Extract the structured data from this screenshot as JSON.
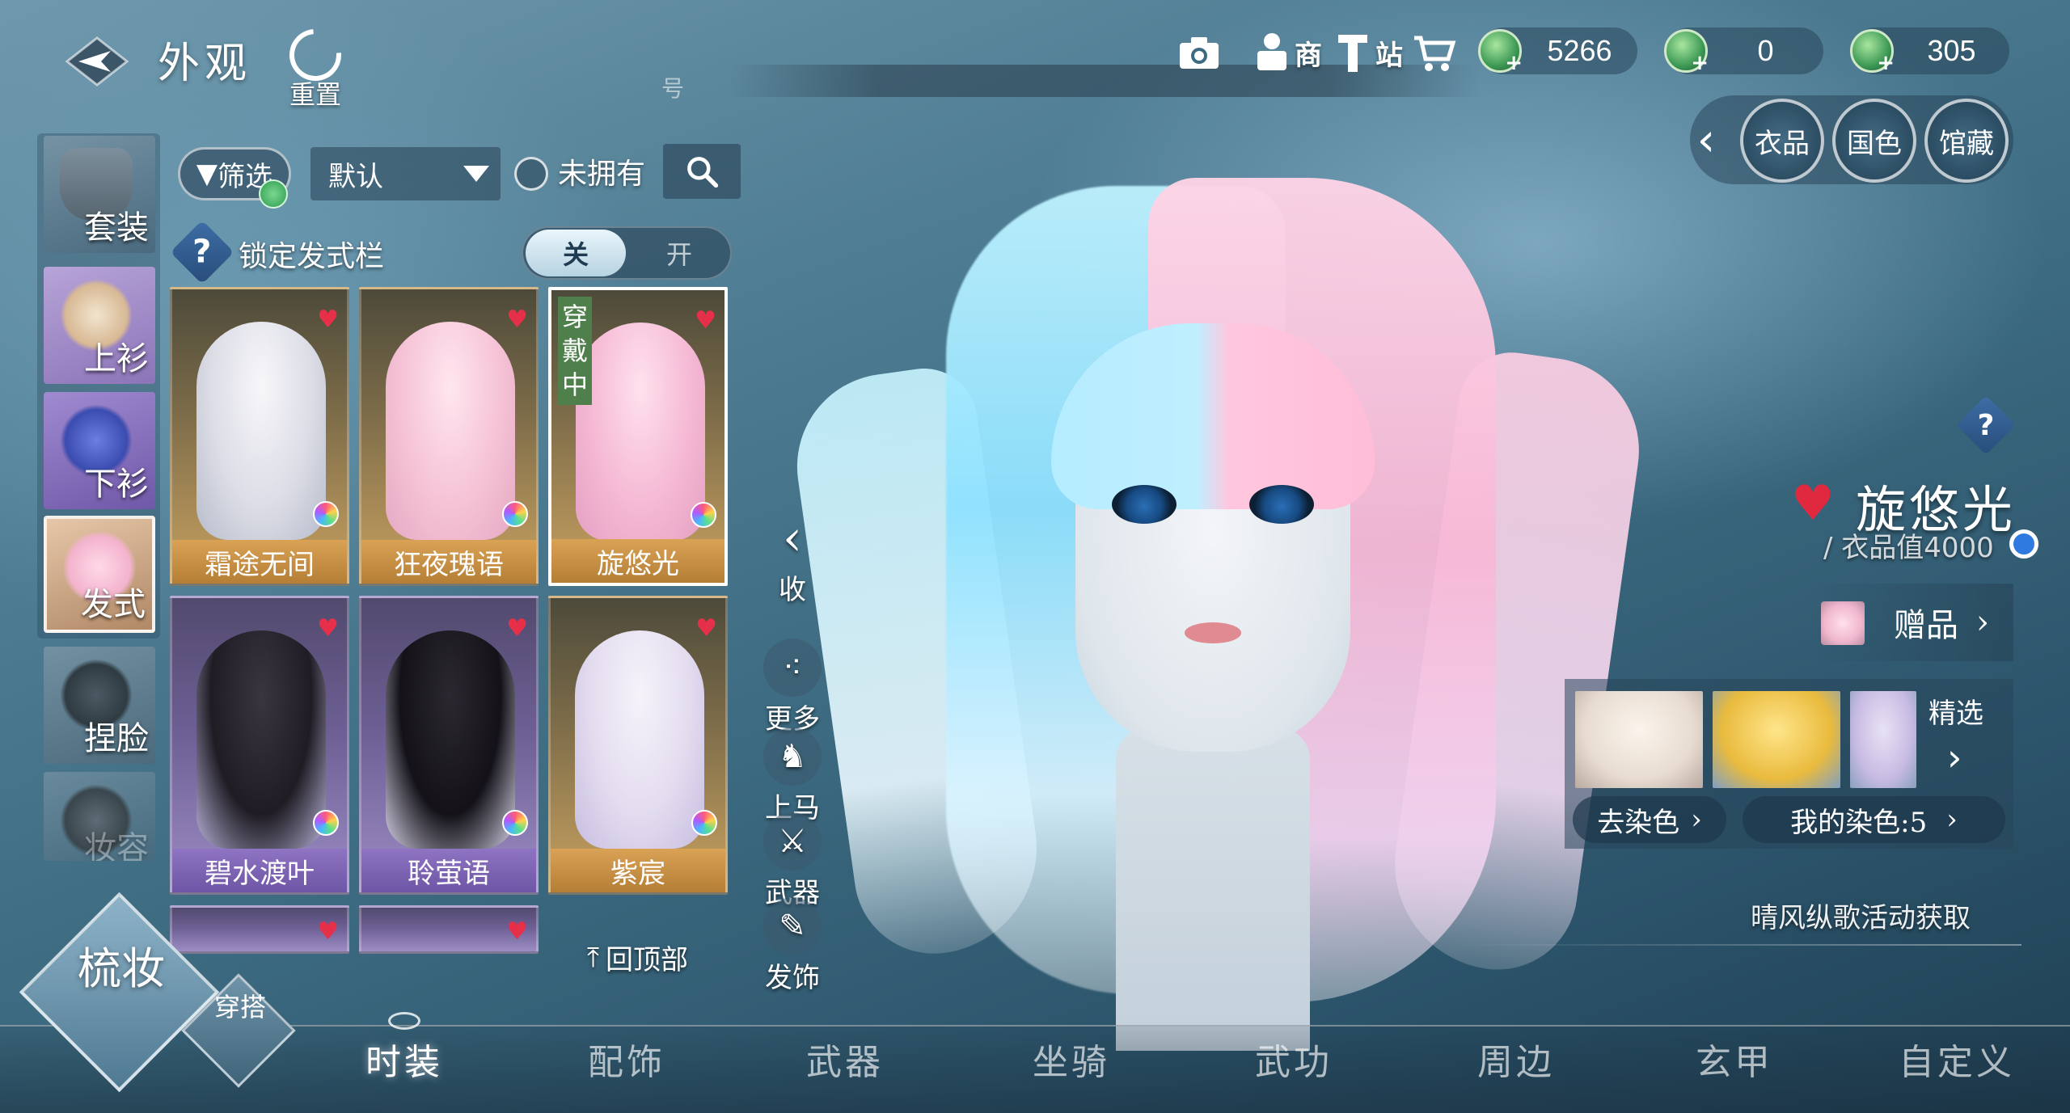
{
  "header": {
    "title": "外观",
    "reset_label": "重置",
    "stray_mark": "号"
  },
  "top_icons": {
    "shop_label": "商",
    "station_label": "站"
  },
  "currencies": [
    {
      "icon": "jade-coin-icon",
      "value": "5266"
    },
    {
      "icon": "jade-coin-icon",
      "value": "0"
    },
    {
      "icon": "jade-coin-icon",
      "value": "305"
    }
  ],
  "circle_tabs": [
    "衣品",
    "国色",
    "馆藏"
  ],
  "categories": [
    "套装",
    "上衫",
    "下衫",
    "发式",
    "捏脸",
    "妆容"
  ],
  "filter": {
    "filter_label": "筛选",
    "sort_value": "默认",
    "unowned_label": "未拥有"
  },
  "lock": {
    "label": "锁定发式栏",
    "off": "关",
    "on": "开"
  },
  "items": [
    {
      "name": "霜途无间"
    },
    {
      "name": "狂夜瑰语"
    },
    {
      "name": "旋悠光",
      "badge": "穿戴中"
    },
    {
      "name": "碧水渡叶"
    },
    {
      "name": "聆萤语"
    },
    {
      "name": "紫宸"
    }
  ],
  "back_to_top": "回顶部",
  "side_actions": {
    "collapse": "收",
    "more": "更多",
    "mount": "上马",
    "weapon": "武器",
    "ornament": "发饰"
  },
  "detail": {
    "title": "旋悠光",
    "value": "/ 衣品值4000",
    "gift_label": "赠品",
    "featured_label": "精选",
    "remove_dye": "去染色",
    "my_dye": "我的染色:5",
    "source": "晴风纵歌活动获取"
  },
  "bottom_tabs": [
    "时装",
    "配饰",
    "武器",
    "坐骑",
    "武功",
    "周边",
    "玄甲",
    "自定义"
  ],
  "modes": {
    "makeup": "梳妆",
    "outfit": "穿搭"
  }
}
